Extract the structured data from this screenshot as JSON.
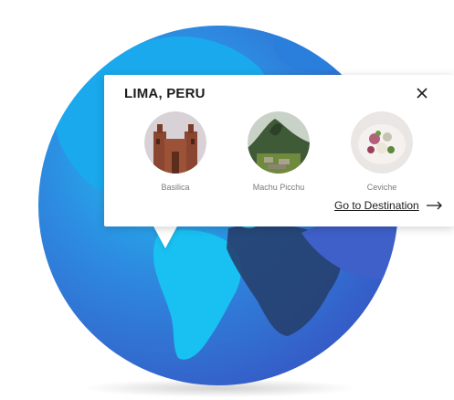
{
  "popup": {
    "title": "LIMA, PERU",
    "close_icon": "close-icon",
    "places": [
      {
        "label": "Basilica",
        "icon": "basilica-photo"
      },
      {
        "label": "Machu Picchu",
        "icon": "machu-picchu-photo"
      },
      {
        "label": "Ceviche",
        "icon": "ceviche-photo"
      }
    ],
    "go_to_label": "Go to Destination",
    "go_to_icon": "arrow-right-icon"
  },
  "colors": {
    "ocean_light": "#1fc3f4",
    "ocean_mid": "#2d8be0",
    "ocean_dark": "#3560c8",
    "land_blue": "#7c8fdc",
    "land_navy": "#26406f",
    "text_dark": "#1d1d1d",
    "text_muted": "#7b7b7b"
  }
}
